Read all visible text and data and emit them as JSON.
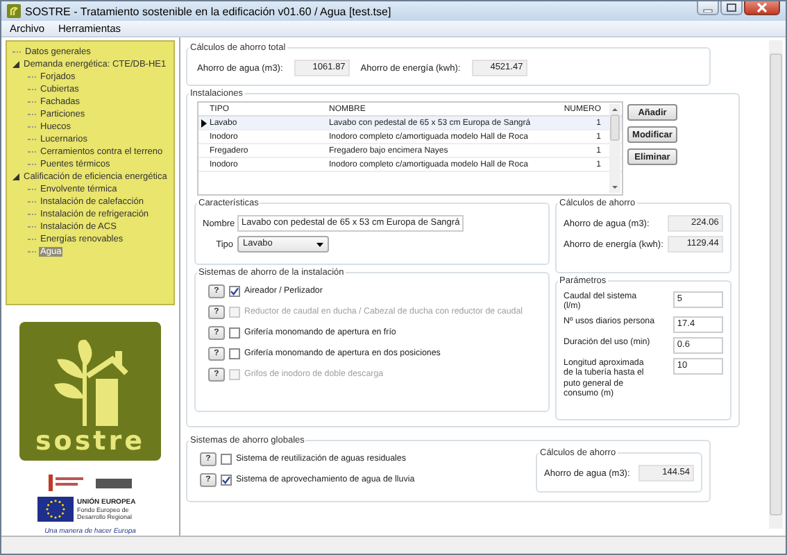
{
  "window": {
    "title": "SOSTRE - Tratamiento sostenible en la edificación v01.60 / Agua [test.tse]"
  },
  "menu": [
    "Archivo",
    "Herramientas"
  ],
  "tree": [
    {
      "label": "Datos generales",
      "selected": false
    },
    {
      "label": "Demanda energética: CTE/DB-HE1",
      "selected": false,
      "expanded": true,
      "children": [
        {
          "label": "Forjados",
          "selected": false
        },
        {
          "label": "Cubiertas",
          "selected": false
        },
        {
          "label": "Fachadas",
          "selected": false
        },
        {
          "label": "Particiones",
          "selected": false
        },
        {
          "label": "Huecos",
          "selected": false
        },
        {
          "label": "Lucernarios",
          "selected": false
        },
        {
          "label": "Cerramientos contra el terreno",
          "selected": false
        },
        {
          "label": "Puentes térmicos",
          "selected": false
        }
      ]
    },
    {
      "label": "Calificación de eficiencia energética",
      "selected": false,
      "expanded": true,
      "children": [
        {
          "label": "Envolvente térmica",
          "selected": false
        },
        {
          "label": "Instalación de calefacción",
          "selected": false
        },
        {
          "label": "Instalación de refrigeración",
          "selected": false
        },
        {
          "label": "Instalación de ACS",
          "selected": false
        },
        {
          "label": "Energías renovables",
          "selected": false
        },
        {
          "label": "Agua",
          "selected": true
        }
      ]
    }
  ],
  "logos": {
    "logo_text": "sostre",
    "eu_title": "UNIÓN EUROPEA",
    "eu_subtitle": "Fondo Europeo de Desarrollo Regional",
    "motto": "Una manera de hacer Europa"
  },
  "totals": {
    "legend": "Cálculos de ahorro total",
    "fields": [
      {
        "label": "Ahorro de agua (m3):",
        "value": "1061.87"
      },
      {
        "label": "Ahorro de energía (kwh):",
        "value": "4521.47"
      }
    ]
  },
  "installations": {
    "legend": "Instalaciones",
    "columns": [
      "TIPO",
      "NOMBRE",
      "NUMERO"
    ],
    "rows": [
      {
        "cells": [
          "Lavabo",
          "Lavabo con pedestal de 65 x 53 cm Europa de Sangrá",
          "1"
        ],
        "selected": true
      },
      {
        "cells": [
          "Inodoro",
          "Inodoro completo c/amortiguada modelo Hall de Roca",
          "1"
        ],
        "selected": false
      },
      {
        "cells": [
          "Fregadero",
          "Fregadero bajo encimera Nayes",
          "1"
        ],
        "selected": false
      },
      {
        "cells": [
          "Inodoro",
          "Inodoro completo c/amortiguada modelo Hall de Roca",
          "1"
        ],
        "selected": false
      }
    ],
    "buttons": [
      "Añadir",
      "Modificar",
      "Eliminar"
    ]
  },
  "characteristics": {
    "legend": "Características",
    "name_label": "Nombre",
    "name_value": "Lavabo con pedestal de 65 x 53 cm Europa de Sangrá",
    "type_label": "Tipo",
    "type_value": "Lavabo"
  },
  "item_savings": {
    "legend": "Cálculos de ahorro",
    "fields": [
      {
        "label": "Ahorro de agua (m3):",
        "value": "224.06"
      },
      {
        "label": "Ahorro de energía (kwh):",
        "value": "1129.44"
      }
    ]
  },
  "systems": {
    "legend": "Sistemas de ahorro de la instalación",
    "items": [
      {
        "help": "?",
        "label": "Aireador / Perlizador",
        "checked": true,
        "disabled": false
      },
      {
        "help": "?",
        "label": "Reductor de caudal en ducha / Cabezal de ducha con reductor de caudal",
        "checked": false,
        "disabled": true
      },
      {
        "help": "?",
        "label": "Grifería monomando de apertura en frío",
        "checked": false,
        "disabled": false
      },
      {
        "help": "?",
        "label": "Grifería monomando de apertura en dos posiciones",
        "checked": false,
        "disabled": false
      },
      {
        "help": "?",
        "label": "Grifos de inodoro de doble descarga",
        "checked": false,
        "disabled": true
      }
    ]
  },
  "parameters": {
    "legend": "Parámetros",
    "fields": [
      {
        "label": "Caudal del sistema (l/m)",
        "value": "5"
      },
      {
        "label": "Nº usos diarios persona",
        "value": "17.4"
      },
      {
        "label": "Duración del uso (min)",
        "value": "0.6"
      },
      {
        "label": "Longitud aproximada de la tubería hasta el puto general de consumo (m)",
        "value": "10"
      }
    ]
  },
  "global_systems": {
    "legend": "Sistemas de ahorro globales",
    "items": [
      {
        "help": "?",
        "label": "Sistema de reutilización de aguas residuales",
        "checked": false,
        "disabled": false
      },
      {
        "help": "?",
        "label": "Sistema de aprovechamiento de agua de lluvia",
        "checked": true,
        "disabled": false
      }
    ],
    "savings": {
      "legend": "Cálculos de ahorro",
      "fields": [
        {
          "label": "Ahorro de agua (m3):",
          "value": "144.54"
        }
      ]
    }
  }
}
